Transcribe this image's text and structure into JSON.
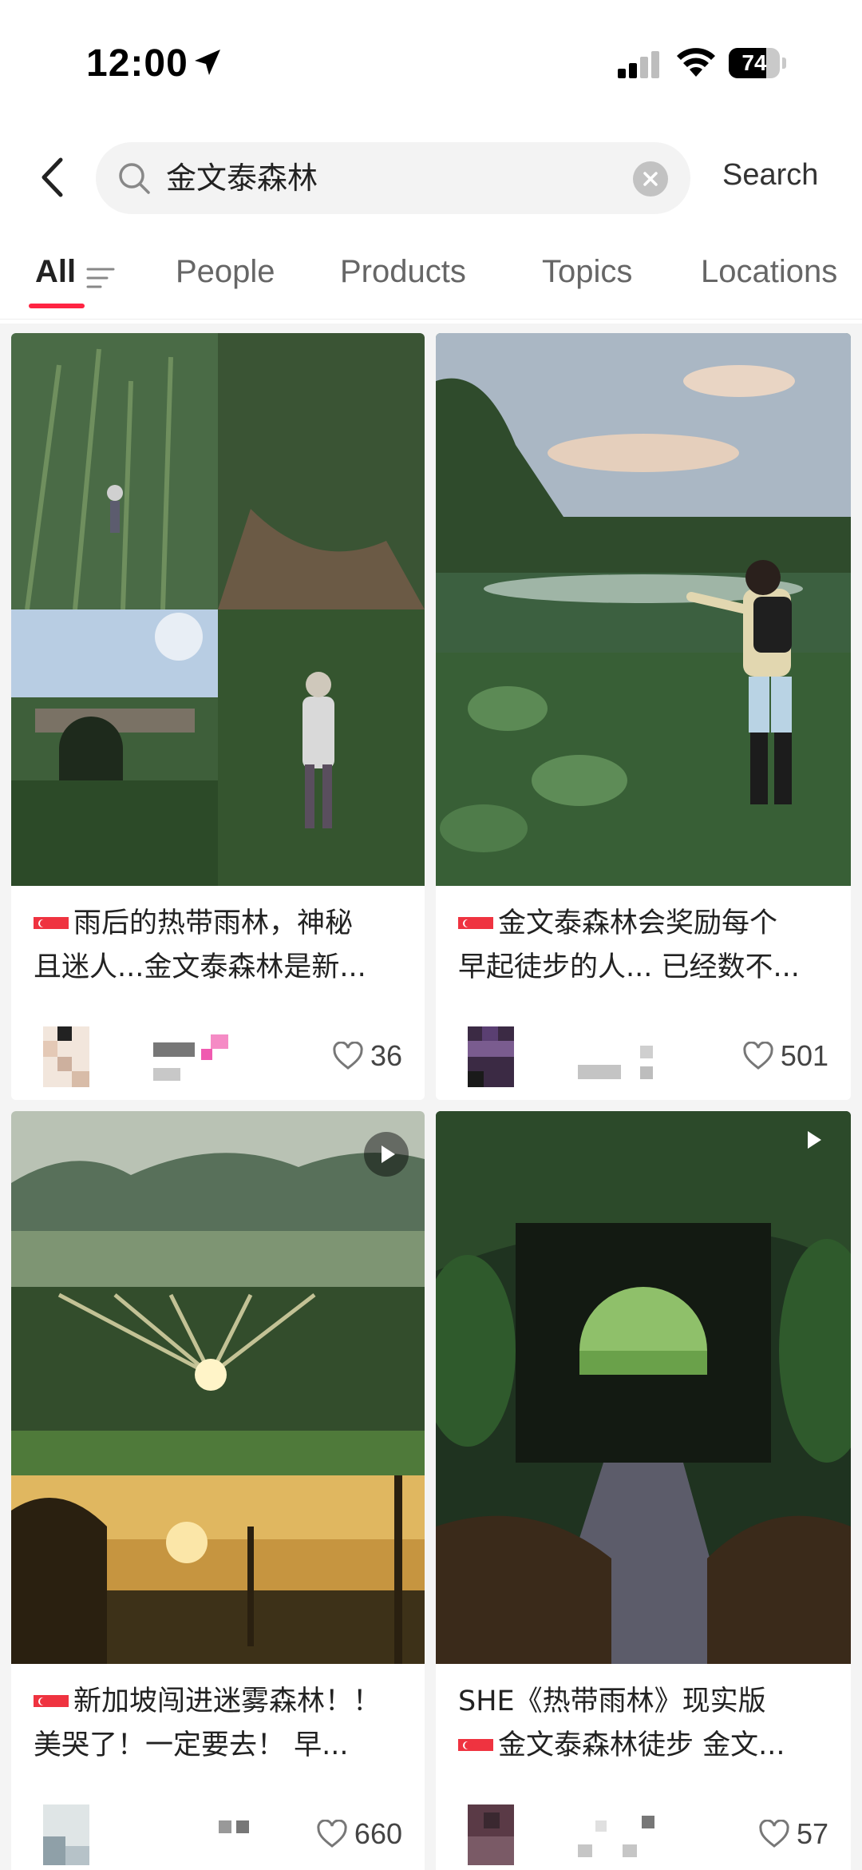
{
  "status_bar": {
    "time": "12:00",
    "battery": "74",
    "battery_level": 0.74
  },
  "search": {
    "query": "金文泰森林",
    "submit_label": "Search"
  },
  "tabs": [
    {
      "label": "All",
      "active": true
    },
    {
      "label": "People",
      "active": false
    },
    {
      "label": "Products",
      "active": false
    },
    {
      "label": "Topics",
      "active": false
    },
    {
      "label": "Locations",
      "active": false
    }
  ],
  "colors": {
    "accent": "#ff2442",
    "background": "#f4f4f4",
    "card": "#ffffff",
    "foliage": "#2f5a2c"
  },
  "posts": [
    {
      "title_line1": "雨后的热带雨林，神秘",
      "title_line2": "且迷人...金文泰森林是新...",
      "has_flag": true,
      "likes": "36",
      "is_video": false,
      "image": "collage-rainforest"
    },
    {
      "title_line1": "金文泰森林会奖励每个",
      "title_line2": "早起徒步的人... 已经数不...",
      "has_flag": true,
      "likes": "501",
      "is_video": false,
      "image": "woman-in-field"
    },
    {
      "title_line1": "新加坡闯进迷雾森林！！",
      "title_line2": "美哭了！一定要去！ 早...",
      "has_flag": true,
      "likes": "660",
      "is_video": true,
      "image": "misty-forest-collage"
    },
    {
      "title_line1": "SHE《热带雨林》现实版",
      "title_line2": "金文泰森林徒步 金文...",
      "has_flag_line2": true,
      "likes": "57",
      "is_video": true,
      "image": "tunnel-railway"
    }
  ],
  "icons": {
    "back": "chevron-left-icon",
    "search": "search-icon",
    "clear": "clear-icon",
    "filter": "filter-icon",
    "like": "heart-icon",
    "play": "play-icon",
    "location": "location-arrow-icon",
    "flag": "singapore-flag-icon"
  }
}
